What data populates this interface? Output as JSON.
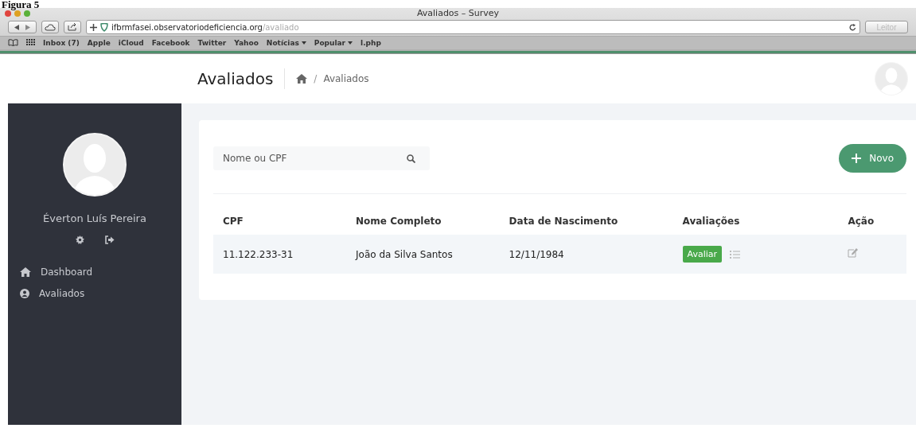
{
  "caption": "Figura 5",
  "window": {
    "title": "Avaliados – Survey"
  },
  "toolbar": {
    "url_host": "ifbrmfasei.observatoriodeficiencia.org",
    "url_path": "/avaliado",
    "reader_button": "Leitor",
    "reader_disabled": true
  },
  "bookmarks": [
    {
      "label": "Inbox (7)",
      "dropdown": false
    },
    {
      "label": "Apple",
      "dropdown": false
    },
    {
      "label": "iCloud",
      "dropdown": false
    },
    {
      "label": "Facebook",
      "dropdown": false
    },
    {
      "label": "Twitter",
      "dropdown": false
    },
    {
      "label": "Yahoo",
      "dropdown": false
    },
    {
      "label": "Notícias",
      "dropdown": true
    },
    {
      "label": "Popular",
      "dropdown": true
    },
    {
      "label": "l.php",
      "dropdown": false
    }
  ],
  "header": {
    "title": "Avaliados",
    "breadcrumb_separator": "/",
    "breadcrumb": [
      "Avaliados"
    ]
  },
  "sidebar": {
    "user_name": "Éverton Luís Pereira",
    "items": [
      {
        "label": "Dashboard",
        "kind": "home"
      },
      {
        "label": "Avaliados",
        "kind": "user"
      }
    ]
  },
  "search": {
    "placeholder": "Nome ou CPF"
  },
  "new_button": "Novo",
  "table": {
    "columns": [
      "CPF",
      "Nome Completo",
      "Data de Nascimento",
      "Avaliações",
      "Ação"
    ],
    "rows": [
      {
        "cpf": "11.122.233-31",
        "name": "João da Silva Santos",
        "birth_date": "12/11/1984",
        "evaluate_button": "Avaliar"
      }
    ]
  }
}
